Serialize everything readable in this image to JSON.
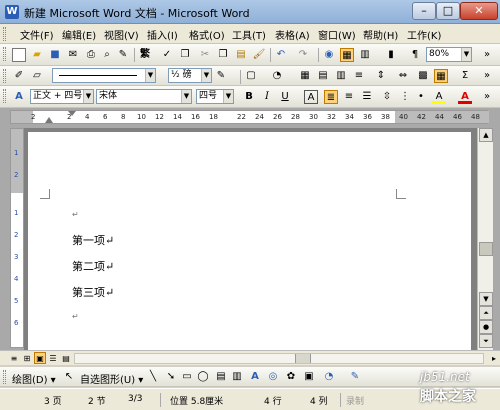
{
  "window": {
    "title": "新建 Microsoft Word 文档 - Microsoft Word",
    "min": "–",
    "max": "□",
    "close": "✕"
  },
  "menu": [
    "文件(F)",
    "编辑(E)",
    "视图(V)",
    "插入(I)",
    "格式(O)",
    "工具(T)",
    "表格(A)",
    "窗口(W)",
    "帮助(H)",
    "工作(K)"
  ],
  "toolbar1": {
    "zoom": "80%",
    "traditional": "繁"
  },
  "toolbar2": {
    "line_weight": "½ 磅"
  },
  "toolbar3": {
    "style": "正文 + 四号",
    "font": "宋体",
    "size": "四号",
    "bold": "B",
    "italic": "I",
    "underline": "U",
    "font_color_letter": "A",
    "highlight_letter": "A"
  },
  "ruler": {
    "marks": [
      "2",
      "2",
      "4",
      "6",
      "8",
      "10",
      "12",
      "14",
      "16",
      "18",
      "22",
      "24",
      "26",
      "28",
      "30",
      "32",
      "34",
      "36",
      "38",
      "40",
      "42",
      "44",
      "46",
      "48"
    ]
  },
  "vruler": {
    "marks": [
      "1",
      "2",
      "1",
      "2",
      "3",
      "4",
      "5",
      "6"
    ]
  },
  "document": {
    "paragraph_mark": "↵",
    "lines": [
      "第一项↵",
      "第二项↵",
      "第三项↵"
    ]
  },
  "drawbar": {
    "draw": "绘图(D) ▾",
    "autoshapes": "自选图形(U) ▾"
  },
  "status": {
    "page": "3 页",
    "section": "2 节",
    "pages": "3/3",
    "position": "位置 5.8厘米",
    "line": "4 行",
    "col": "4 列",
    "rec": "录制"
  },
  "watermark": {
    "site": "jb51.net",
    "brand": "脚本之家"
  },
  "colors": {
    "title_bar": "#8fb0d8",
    "accent_orange": "#ffd27a",
    "font_color_red": "#e00000",
    "highlight_yellow": "#ffff00"
  }
}
